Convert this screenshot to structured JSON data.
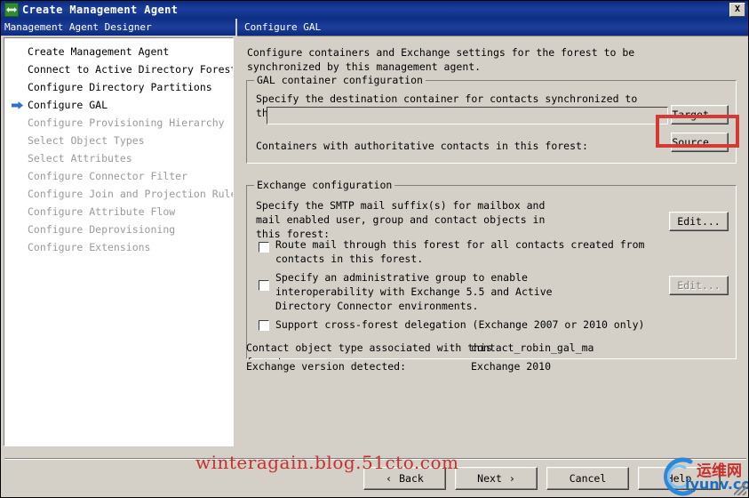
{
  "window": {
    "title": "Create Management Agent",
    "icon": "sync-arrows-icon",
    "close_label": "X"
  },
  "left_pane": {
    "header": "Management Agent Designer",
    "items": [
      {
        "label": "Create Management Agent",
        "state": "done"
      },
      {
        "label": "Connect to Active Directory Forest",
        "state": "done"
      },
      {
        "label": "Configure Directory Partitions",
        "state": "done"
      },
      {
        "label": "Configure GAL",
        "state": "current"
      },
      {
        "label": "Configure Provisioning Hierarchy",
        "state": "disabled"
      },
      {
        "label": "Select Object Types",
        "state": "disabled"
      },
      {
        "label": "Select Attributes",
        "state": "disabled"
      },
      {
        "label": "Configure Connector Filter",
        "state": "disabled"
      },
      {
        "label": "Configure Join and Projection Rules",
        "state": "disabled"
      },
      {
        "label": "Configure Attribute Flow",
        "state": "disabled"
      },
      {
        "label": "Configure Deprovisioning",
        "state": "disabled"
      },
      {
        "label": "Configure Extensions",
        "state": "disabled"
      }
    ]
  },
  "right_pane": {
    "header": "Configure GAL",
    "intro_line1": "Configure containers and Exchange settings for the forest to be",
    "intro_line2": "synchronized by this management agent.",
    "gal_group": {
      "title": "GAL container configuration",
      "destination_label_line1": "Specify the destination container for contacts synchronized to",
      "destination_label_line2": "this forest:",
      "destination_value": "",
      "destination_placeholder": "",
      "target_button": "Target...",
      "authoritative_label": "Containers with authoritative contacts in this forest:",
      "source_button": "Source..."
    },
    "exchange_group": {
      "title": "Exchange configuration",
      "smtp_label_line1": "Specify the SMTP mail suffix(s) for mailbox and",
      "smtp_label_line2": "mail enabled user, group and contact objects in",
      "smtp_label_line3": "this forest:",
      "smtp_edit_button": "Edit...",
      "route_mail_checkbox": {
        "line1": "Route mail through this forest for all contacts created from",
        "line2": "contacts in this forest.",
        "checked": false
      },
      "admin_group_checkbox": {
        "line1": "Specify an administrative group to enable",
        "line2": "interoperability with Exchange 5.5 and Active",
        "line3": "Directory Connector environments.",
        "checked": false
      },
      "admin_group_edit_button": "Edit...",
      "cross_forest_checkbox": {
        "line1": "Support cross-forest delegation (Exchange 2007 or 2010 only)",
        "checked": false
      }
    },
    "info": {
      "contact_type_label_line1": "Contact object type associated with this",
      "contact_type_label_line2": "forest:",
      "contact_type_value": "contact_robin_gal_ma",
      "exchange_version_label": "Exchange version detected:",
      "exchange_version_value": "Exchange 2010"
    }
  },
  "footer": {
    "back_button": "Back",
    "back_glyph": "‹",
    "next_button": "Next",
    "next_glyph": "›",
    "cancel_button": "Cancel",
    "help_button": "Help"
  },
  "overlays": {
    "watermark_text": "winteragain.blog.51cto.com",
    "watermark_color": "#c8302c",
    "logo_cn": "运维网",
    "logo_en": "iyunv.com",
    "highlight_color": "#d43a33"
  }
}
